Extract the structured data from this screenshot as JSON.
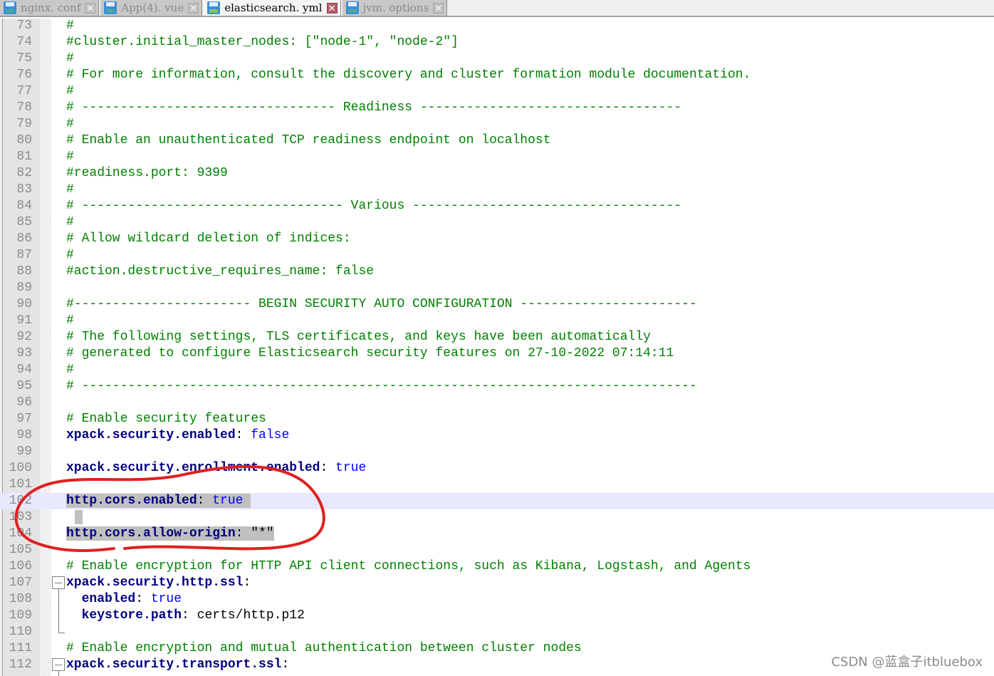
{
  "tabs": [
    {
      "label": "nginx. conf",
      "active": false
    },
    {
      "label": "App(4). vue",
      "active": false
    },
    {
      "label": "elasticsearch. yml",
      "active": true
    },
    {
      "label": "jvm. options",
      "active": false
    }
  ],
  "editor": {
    "current_line": 102,
    "lines": [
      {
        "n": "73",
        "text": "#"
      },
      {
        "n": "74",
        "text": "#cluster.initial_master_nodes: [\"node-1\", \"node-2\"]"
      },
      {
        "n": "75",
        "text": "#"
      },
      {
        "n": "76",
        "text": "# For more information, consult the discovery and cluster formation module documentation."
      },
      {
        "n": "77",
        "text": "#"
      },
      {
        "n": "78",
        "text": "# --------------------------------- Readiness ----------------------------------"
      },
      {
        "n": "79",
        "text": "#"
      },
      {
        "n": "80",
        "text": "# Enable an unauthenticated TCP readiness endpoint on localhost"
      },
      {
        "n": "81",
        "text": "#"
      },
      {
        "n": "82",
        "text": "#readiness.port: 9399"
      },
      {
        "n": "83",
        "text": "#"
      },
      {
        "n": "84",
        "text": "# ---------------------------------- Various -----------------------------------"
      },
      {
        "n": "85",
        "text": "#"
      },
      {
        "n": "86",
        "text": "# Allow wildcard deletion of indices:"
      },
      {
        "n": "87",
        "text": "#"
      },
      {
        "n": "88",
        "text": "#action.destructive_requires_name: false"
      },
      {
        "n": "89",
        "text": ""
      },
      {
        "n": "90",
        "text": "#----------------------- BEGIN SECURITY AUTO CONFIGURATION -----------------------"
      },
      {
        "n": "91",
        "text": "#"
      },
      {
        "n": "92",
        "text": "# The following settings, TLS certificates, and keys have been automatically"
      },
      {
        "n": "93",
        "text": "# generated to configure Elasticsearch security features on 27-10-2022 07:14:11"
      },
      {
        "n": "94",
        "text": "#"
      },
      {
        "n": "95",
        "text": "# --------------------------------------------------------------------------------"
      },
      {
        "n": "96",
        "text": ""
      },
      {
        "n": "97",
        "text": "# Enable security features"
      },
      {
        "n": "98",
        "key": "xpack.security.enabled",
        "value": "false",
        "value_kind": "kw"
      },
      {
        "n": "99",
        "text": ""
      },
      {
        "n": "100",
        "key": "xpack.security.enrollment.enabled",
        "value": "true",
        "value_kind": "kw"
      },
      {
        "n": "101",
        "text": ""
      },
      {
        "n": "102",
        "key": "http.cors.enabled",
        "value": "true",
        "value_kind": "kw",
        "selected": true
      },
      {
        "n": "103",
        "text": "",
        "selected": true
      },
      {
        "n": "104",
        "key": "http.cors.allow-origin",
        "value": "\"*\"",
        "value_kind": "val",
        "selected": true
      },
      {
        "n": "105",
        "text": ""
      },
      {
        "n": "106",
        "text": "# Enable encryption for HTTP API client connections, such as Kibana, Logstash, and Agents"
      },
      {
        "n": "107",
        "key": "xpack.security.http.ssl",
        "value": "",
        "fold": "start"
      },
      {
        "n": "108",
        "key": "  enabled",
        "value": "true",
        "value_kind": "kw"
      },
      {
        "n": "109",
        "key": "  keystore.path",
        "value": "certs/http.p12",
        "value_kind": "val"
      },
      {
        "n": "110",
        "text": "",
        "fold": "end"
      },
      {
        "n": "111",
        "text": "# Enable encryption and mutual authentication between cluster nodes"
      },
      {
        "n": "112",
        "key": "xpack.security.transport.ssl",
        "value": "",
        "fold": "start"
      }
    ]
  },
  "annotation": {
    "shape": "freehand-circle",
    "color": "#e02020",
    "target_lines": [
      102,
      103,
      104
    ]
  },
  "watermark": "CSDN @蓝盒子itbluebox"
}
